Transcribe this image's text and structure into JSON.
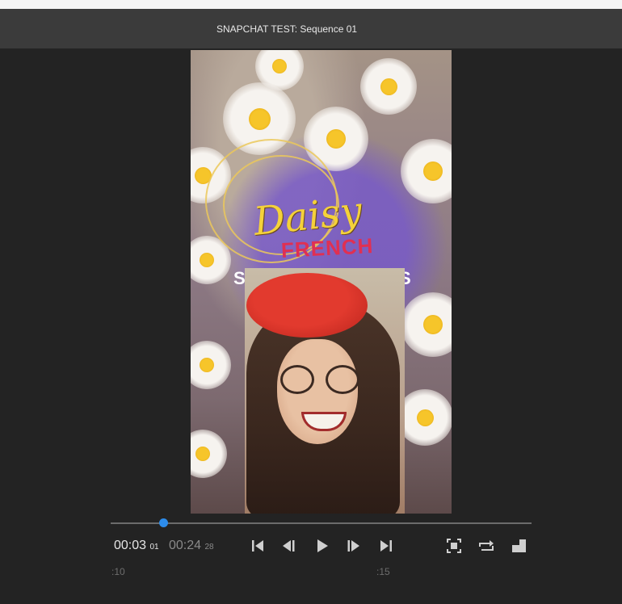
{
  "window": {
    "title": "SNAPCHAT TEST: Sequence 01"
  },
  "frame": {
    "brand_word": "Daisy",
    "brand_sub": "FRENCH",
    "overlay_left": "S",
    "overlay_right": "S"
  },
  "player": {
    "current_time": "00:03",
    "current_frames": "01",
    "duration": "00:24",
    "duration_frames": "28",
    "playhead_fraction": 0.125,
    "ruler": [
      ":10",
      ":15"
    ],
    "accent_color": "#2d8ceb"
  },
  "controls": {
    "go_to_in": "skip-back-icon",
    "step_back": "step-back-icon",
    "play": "play-icon",
    "step_forward": "step-forward-icon",
    "go_to_out": "skip-forward-icon",
    "safe_margins": "safe-margins-icon",
    "loop": "loop-icon",
    "export_frame": "export-frame-icon"
  }
}
